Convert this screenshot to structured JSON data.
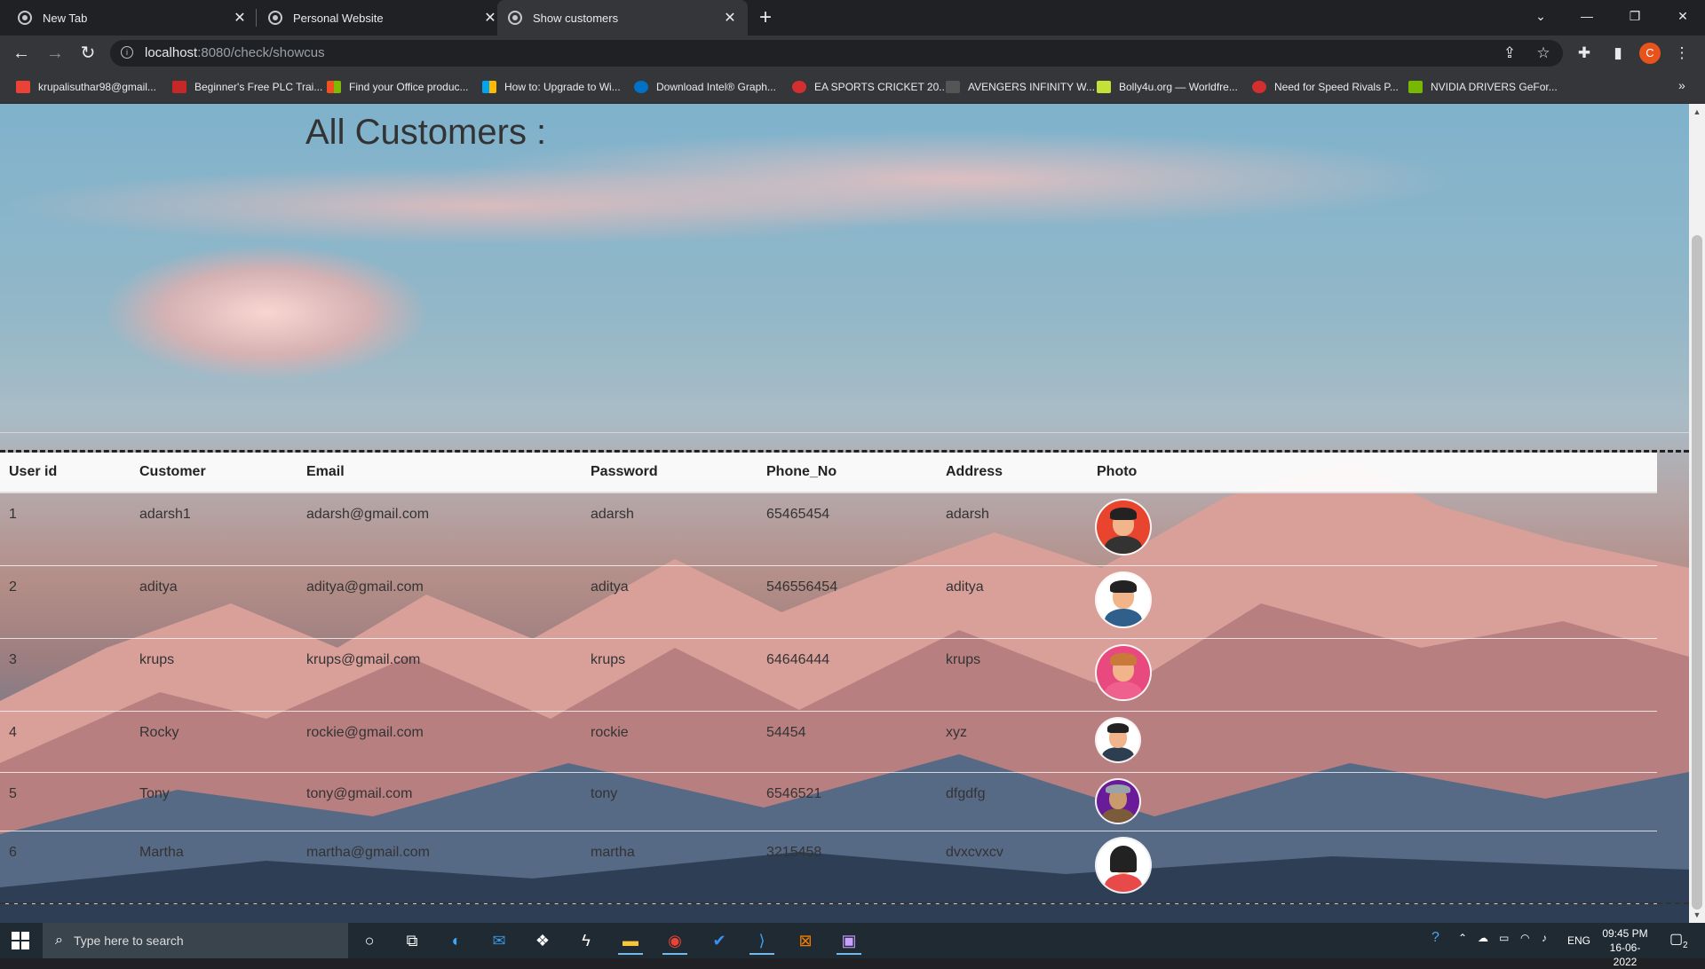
{
  "tabs": [
    {
      "label": "New Tab",
      "active": false
    },
    {
      "label": "Personal Website",
      "active": false
    },
    {
      "label": "Show customers",
      "active": true
    }
  ],
  "tab_close_glyph": "✕",
  "new_tab_glyph": "+",
  "address_bar": {
    "host": "localhost",
    "path": ":8080/check/showcus"
  },
  "bookmarks": [
    {
      "label": "krupalisuthar98@gmail...",
      "icon": "gmail-icon",
      "color": "#ea4335"
    },
    {
      "label": "Beginner's Free PLC Trai...",
      "icon": "plc-icon",
      "color": "#c62828"
    },
    {
      "label": "Find your Office produc...",
      "icon": "microsoft-icon",
      "color": "#f25022"
    },
    {
      "label": "How to: Upgrade to Wi...",
      "icon": "microsoft-icon",
      "color": "#7fba00"
    },
    {
      "label": "Download Intel® Graph...",
      "icon": "intel-icon",
      "color": "#0071c5"
    },
    {
      "label": "EA SPORTS CRICKET 20...",
      "icon": "cricket-icon",
      "color": "#d32f2f"
    },
    {
      "label": "AVENGERS INFINITY W...",
      "icon": "hd-icon",
      "color": "#555555"
    },
    {
      "label": "Bolly4u.org — Worldfre...",
      "icon": "bolly-icon",
      "color": "#c6e03a"
    },
    {
      "label": "Need for Speed Rivals P...",
      "icon": "nfs-icon",
      "color": "#d32f2f"
    },
    {
      "label": "NVIDIA DRIVERS GeFor...",
      "icon": "nvidia-icon",
      "color": "#76b900"
    }
  ],
  "bookmarks_more": "»",
  "profile_initial": "C",
  "page": {
    "title": "All Customers :",
    "columns": [
      "User id",
      "Customer",
      "Email",
      "Password",
      "Phone_No",
      "Address",
      "Photo"
    ],
    "rows": [
      {
        "id": "1",
        "customer": "adarsh1",
        "email": "adarsh@gmail.com",
        "password": "adarsh",
        "phone": "65465454",
        "address": "adarsh",
        "avatar_bg": "#e8442e",
        "avatar_body": "#333333"
      },
      {
        "id": "2",
        "customer": "aditya",
        "email": "aditya@gmail.com",
        "password": "aditya",
        "phone": "546556454",
        "address": "aditya",
        "avatar_bg": "#ffffff",
        "avatar_body": "#2f5f8a"
      },
      {
        "id": "3",
        "customer": "krups",
        "email": "krups@gmail.com",
        "password": "krups",
        "phone": "64646444",
        "address": "krups",
        "avatar_bg": "#e84a7f",
        "avatar_body": "#f0608f"
      },
      {
        "id": "4",
        "customer": "Rocky",
        "email": "rockie@gmail.com",
        "password": "rockie",
        "phone": "54454",
        "address": "xyz",
        "avatar_bg": "#ffffff",
        "avatar_body": "#2c3e50"
      },
      {
        "id": "5",
        "customer": "Tony",
        "email": "tony@gmail.com",
        "password": "tony",
        "phone": "6546521",
        "address": "dfgdfg",
        "avatar_bg": "#6a1b9a",
        "avatar_body": "#7b5b3a"
      },
      {
        "id": "6",
        "customer": "Martha",
        "email": "martha@gmail.com",
        "password": "martha",
        "phone": "3215458",
        "address": "dvxcvxcv",
        "avatar_bg": "#ffffff",
        "avatar_body": "#e84a4a"
      }
    ]
  },
  "taskbar": {
    "search_placeholder": "Type here to search",
    "apps": [
      "cortana-icon",
      "task-view-icon",
      "edge-icon",
      "mail-icon",
      "dropbox-icon",
      "bolt-icon",
      "file-explorer-icon",
      "chrome-icon",
      "todo-icon",
      "vscode-icon",
      "xampp-icon",
      "game-icon"
    ],
    "language": "ENG",
    "time": "09:45 PM",
    "date": "16-06-2022",
    "notification_count": "2"
  }
}
